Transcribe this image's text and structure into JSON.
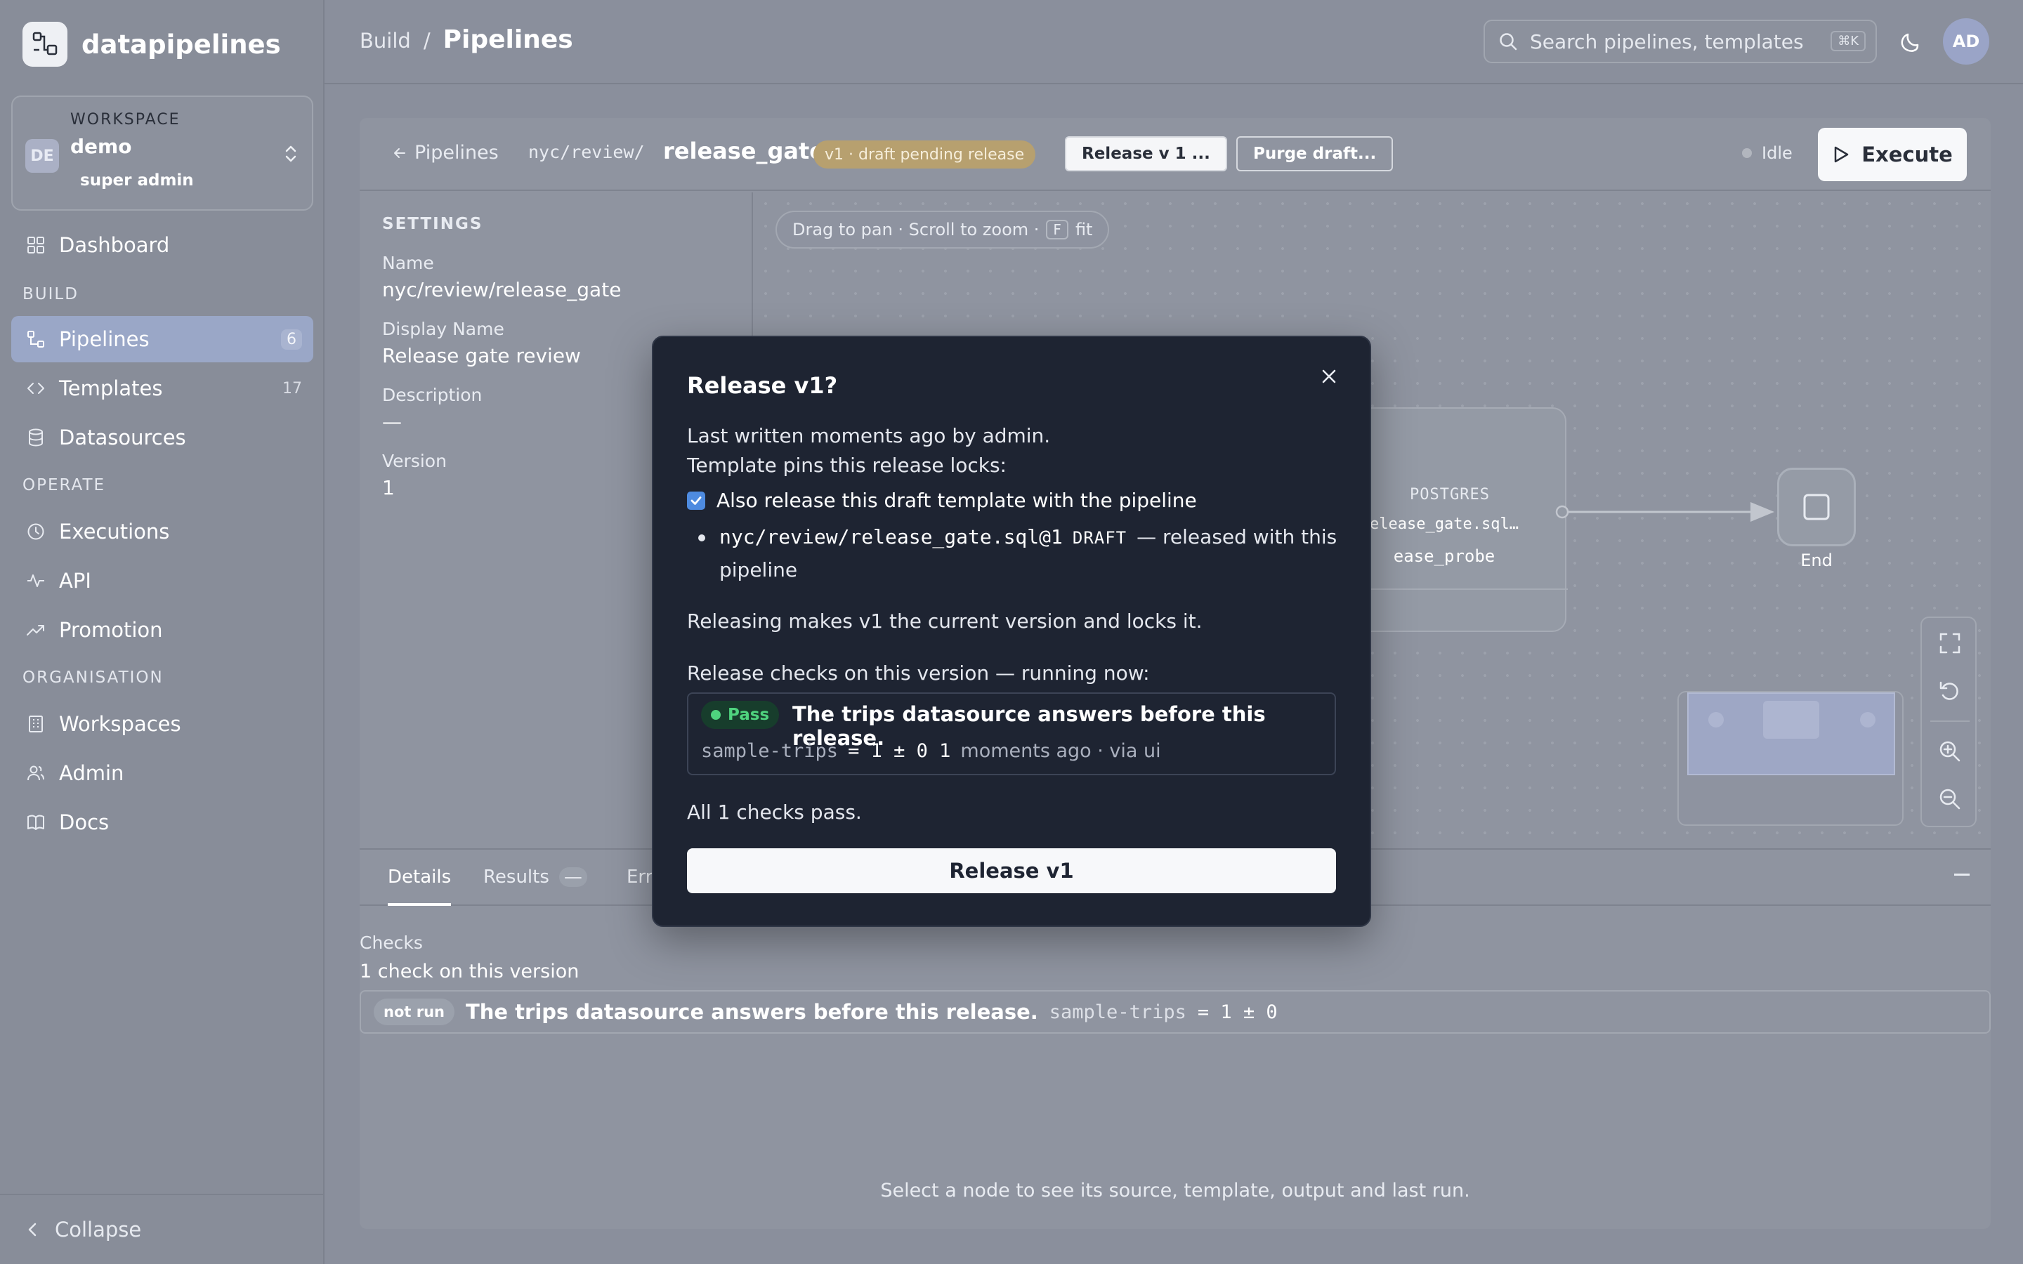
{
  "app": {
    "name": "datapipelines"
  },
  "workspace": {
    "label": "WORKSPACE",
    "initials": "DE",
    "name": "demo",
    "role": "super admin"
  },
  "nav": {
    "dashboard": "Dashboard",
    "section_build": "BUILD",
    "pipelines": "Pipelines",
    "pipelines_count": "6",
    "templates": "Templates",
    "templates_count": "17",
    "datasources": "Datasources",
    "section_operate": "OPERATE",
    "executions": "Executions",
    "api": "API",
    "promotion": "Promotion",
    "section_org": "ORGANISATION",
    "workspaces": "Workspaces",
    "admin": "Admin",
    "docs": "Docs",
    "collapse": "Collapse"
  },
  "topbar": {
    "crumb_build": "Build",
    "crumb_sep": "/",
    "crumb_page": "Pipelines",
    "search_placeholder": "Search pipelines, templates, d",
    "search_kbd": "⌘K",
    "user_initials": "AD"
  },
  "pipeline": {
    "back": "Pipelines",
    "path": "nyc/review/",
    "name": "release_gate",
    "status_pill": "v1 · draft pending release",
    "release_button": "Release v 1 ...",
    "purge_button": "Purge draft...",
    "state": "Idle",
    "execute": "Execute"
  },
  "settings": {
    "heading": "SETTINGS",
    "name_label": "Name",
    "name_value": "nyc/review/release_gate",
    "display_label": "Display Name",
    "display_value": "Release gate review",
    "desc_label": "Description",
    "desc_value": "—",
    "version_label": "Version",
    "version_value": "1"
  },
  "canvas": {
    "hint_pre": "Drag to pan · Scroll to zoom ·",
    "hint_key": "F",
    "hint_post": "fit",
    "node_type": "POSTGRES",
    "node_file": "elease_gate.sql…",
    "node_output": "ease_probe",
    "end_label": "End"
  },
  "bottom": {
    "tab_details": "Details",
    "tab_results": "Results",
    "tab_results_badge": "—",
    "tab_errors": "Err",
    "checks_heading": "Checks",
    "checks_summary": "1 check on this version",
    "check_status": "not run",
    "check_desc": "The trips datasource answers before this release.",
    "check_ds": "sample-trips",
    "check_expr": "= 1 ± 0",
    "select_hint": "Select a node to see its source, template, output and last run."
  },
  "modal": {
    "title": "Release v1?",
    "written": "Last written moments ago by admin.",
    "pins": "Template pins this release locks:",
    "checkbox_label": "Also release this draft template with the pipeline",
    "template_pin": "nyc/review/release_gate.sql@1",
    "template_state": "DRAFT",
    "template_note_a": "— released with this",
    "template_note_b": "pipeline",
    "releasing": "Releasing makes v1 the current version and locks it.",
    "checks_running": "Release checks on this version — running now:",
    "pass": "Pass",
    "check_desc": "The trips datasource answers before this release.",
    "check_ds": "sample-trips",
    "check_result": "= 1 ± 0 1",
    "check_meta": "moments ago · via ui",
    "all_pass": "All 1 checks pass.",
    "confirm": "Release v1"
  }
}
